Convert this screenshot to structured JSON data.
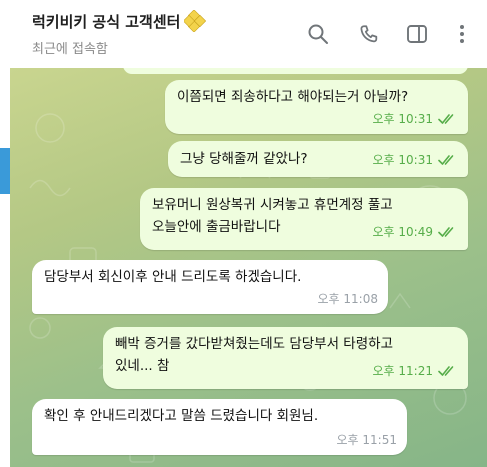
{
  "header": {
    "title": "럭키비키 공식 고객센터",
    "status": "최근에 접속함",
    "icons": [
      "verified-badge-icon",
      "search-icon",
      "phone-icon",
      "sidebar-toggle-icon",
      "more-vertical-icon"
    ]
  },
  "colors": {
    "outgoing_bubble": "#effdde",
    "incoming_bubble": "#ffffff",
    "outgoing_meta": "#56ad49",
    "incoming_meta": "#9aa1a8",
    "verified": "#f3d34b"
  },
  "messages": [
    {
      "direction": "out",
      "lines": [
        "이쯤되면 죄송하다고 해야되는거 아닐까?"
      ],
      "time": "오후 10:31",
      "read": true
    },
    {
      "direction": "out",
      "lines": [
        "그냥 당해줄꺼 같았나?"
      ],
      "time": "오후 10:31",
      "read": true
    },
    {
      "direction": "out",
      "lines": [
        "보유머니 원상복귀 시켜놓고 휴먼계정 풀고",
        "오늘안에 출금바랍니다"
      ],
      "time": "오후 10:49",
      "read": true
    },
    {
      "direction": "in",
      "lines": [
        "담당부서 회신이후 안내 드리도록 하겠습니다."
      ],
      "time": "오후 11:08"
    },
    {
      "direction": "out",
      "lines": [
        "빼박 증거를 갔다받쳐줬는데도 담당부서 타령하고",
        "있네... 참"
      ],
      "time": "오후 11:21",
      "read": true
    },
    {
      "direction": "in",
      "lines": [
        "확인 후 안내드리겠다고 말씀 드렸습니다 회원님."
      ],
      "time": "오후 11:51"
    }
  ]
}
